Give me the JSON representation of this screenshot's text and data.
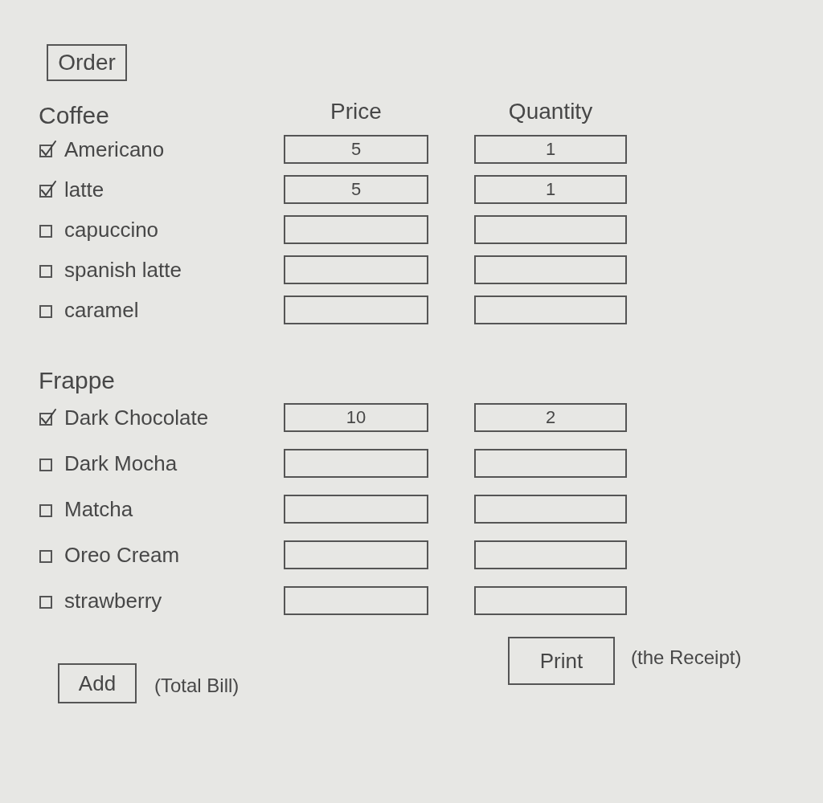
{
  "order_button": {
    "label": "Order"
  },
  "columns": [
    {
      "label": "Price"
    },
    {
      "label": "Quantity"
    }
  ],
  "sections": [
    {
      "title": "Coffee",
      "items": [
        {
          "name": "Americano",
          "checked": true,
          "price": "5",
          "quantity": "1"
        },
        {
          "name": "latte",
          "checked": true,
          "price": "5",
          "quantity": "1"
        },
        {
          "name": "capuccino",
          "checked": false
        },
        {
          "name": "spanish latte",
          "checked": false
        },
        {
          "name": "caramel",
          "checked": false
        }
      ]
    },
    {
      "title": "Frappe",
      "items": [
        {
          "name": "Dark Chocolate",
          "checked": true,
          "price": "10",
          "quantity": "2"
        },
        {
          "name": "Dark Mocha",
          "checked": false
        },
        {
          "name": "Matcha",
          "checked": false
        },
        {
          "name": "Oreo Cream",
          "checked": false
        },
        {
          "name": "strawberry",
          "checked": false
        }
      ]
    }
  ],
  "actions": [
    {
      "label": "Add",
      "note": "(Total Bill)"
    },
    {
      "label": "Print",
      "note": "(the Receipt)"
    }
  ]
}
